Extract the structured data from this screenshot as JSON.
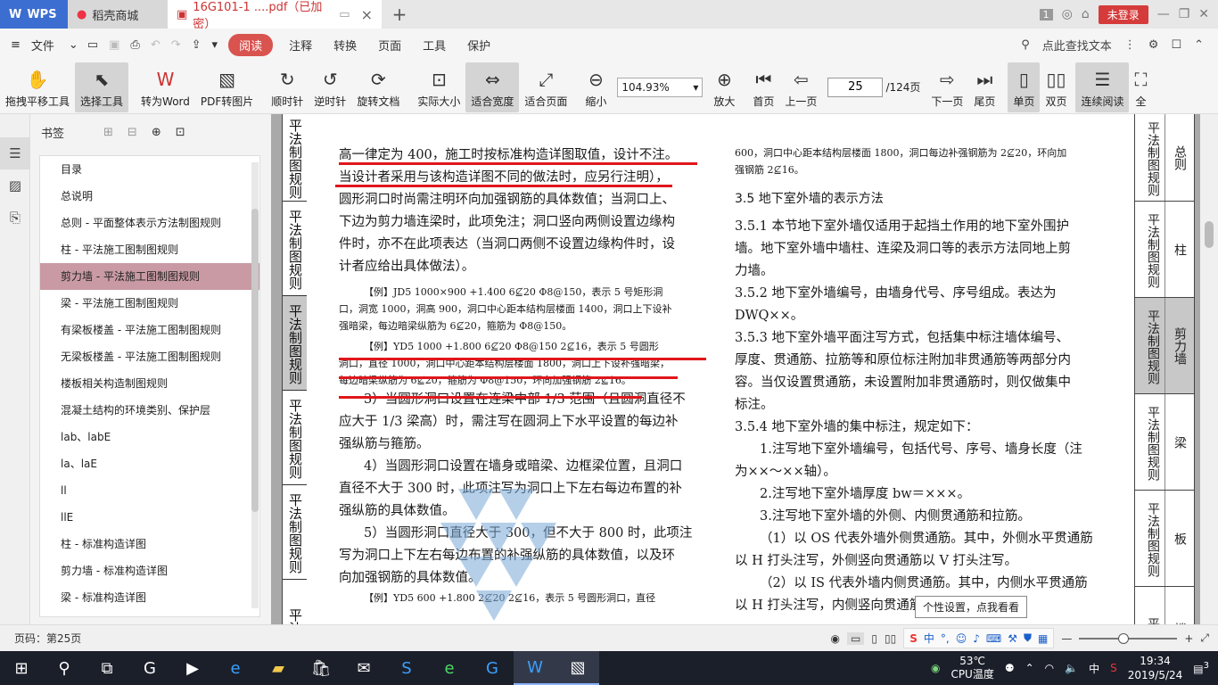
{
  "tabs": {
    "wps": "WPS",
    "shop": "稻壳商城",
    "doc": "16G101-1 ....pdf（已加密）",
    "badge": "1",
    "login": "未登录"
  },
  "menu": {
    "file": "文件",
    "items": [
      "阅读",
      "注释",
      "转换",
      "页面",
      "工具",
      "保护"
    ],
    "search": "点此查找文本"
  },
  "toolbar": {
    "hand": "拖拽平移工具",
    "select": "选择工具",
    "toword": "转为Word",
    "topic": "PDF转图片",
    "cw": "顺时针",
    "ccw": "逆时针",
    "rotate": "旋转文档",
    "actual": "实际大小",
    "fitw": "适合宽度",
    "fitp": "适合页面",
    "zoomout": "缩小",
    "zoomval": "104.93%",
    "zoomin": "放大",
    "first": "首页",
    "prev": "上一页",
    "page": "25",
    "total": "/124页",
    "next": "下一页",
    "last": "尾页",
    "single": "单页",
    "double": "双页",
    "continuous": "连续阅读",
    "full": "全"
  },
  "bookmark": {
    "title": "书签",
    "items": [
      "目录",
      "总说明",
      "总则 - 平面整体表示方法制图规则",
      "柱 - 平法施工图制图规则",
      "剪力墙 - 平法施工图制图规则",
      "梁 - 平法施工图制图规则",
      "有梁板楼盖 - 平法施工图制图规则",
      "无梁板楼盖 - 平法施工图制图规则",
      "楼板相关构造制图规则",
      "混凝土结构的环境类别、保护层",
      "lab、labE",
      "la、laE",
      "ll",
      "llE",
      "柱 - 标准构造详图",
      "剪力墙 - 标准构造详图",
      "梁 - 标准构造详图"
    ],
    "selected": 4
  },
  "sideTabs": [
    "平法制图规则",
    "平法制图规则",
    "平法制图规则",
    "平法制图规则",
    "平法制图规则",
    "平法制"
  ],
  "leftCol": [
    "高一律定为 400，施工时按标准构造详图取值，设计不注。",
    "当设计者采用与该构造详图不同的做法时，应另行注明），",
    "圆形洞口时尚需注明环向加强钢筋的具体数值；当洞口上、",
    "下边为剪力墙连梁时，此项免注；洞口竖向两侧设置边缘构",
    "件时，亦不在此项表达（当洞口两侧不设置边缘构件时，设",
    "计者应给出具体做法）。"
  ],
  "ex1": [
    "【例】JD5  1000×900  +1.400  6⊈20  Φ8@150，表示 5 号矩形洞",
    "口，洞宽 1000，洞高 900，洞口中心距本结构层楼面 1400，洞口上下设补",
    "强暗梁，每边暗梁纵筋为 6⊈20，箍筋为 Φ8@150。"
  ],
  "ex2": [
    "【例】YD5  1000  +1.800  6⊈20  Φ8@150  2⊈16，表示 5 号圆形",
    "洞口，直径 1000，洞口中心距本结构层楼面 1800，洞口上下设补强暗梁，",
    "每边暗梁纵筋为 6⊈20，箍筋为 Φ8@150，环向加强钢筋 2⊈16。"
  ],
  "leftCol2": [
    "3）当圆形洞口设置在连梁中部 1/3 范围（且圆洞直径不",
    "应大于 1/3 梁高）时，需注写在圆洞上下水平设置的每边补",
    "强纵筋与箍筋。",
    "4）当圆形洞口设置在墙身或暗梁、边框梁位置，且洞口",
    "直径不大于 300 时，此项注写为洞口上下左右每边布置的补",
    "强纵筋的具体数值。",
    "5）当圆形洞口直径大于 300，但不大于 800 时，此项注",
    "写为洞口上下左右每边布置的补强纵筋的具体数值，以及环",
    "向加强钢筋的具体数值。"
  ],
  "ex3": "【例】YD5  600  +1.800  2⊈20  2⊈16，表示 5 号圆形洞口，直径",
  "rightTop": [
    "600，洞口中心距本结构层楼面 1800，洞口每边补强钢筋为 2⊈20，环向加",
    "强钢筋 2⊈16。"
  ],
  "sec35": "3.5  地下室外墙的表示方法",
  "rightCol": [
    "3.5.1  本节地下室外墙仅适用于起挡土作用的地下室外围护",
    "墙。地下室外墙中墙柱、连梁及洞口等的表示方法同地上剪",
    "力墙。",
    "3.5.2  地下室外墙编号，由墙身代号、序号组成。表达为",
    "DWQ××。",
    "3.5.3  地下室外墙平面注写方式，包括集中标注墙体编号、",
    "厚度、贯通筋、拉筋等和原位标注附加非贯通筋等两部分内",
    "容。当仅设置贯通筋，未设置附加非贯通筋时，则仅做集中",
    "标注。",
    "3.5.4  地下室外墙的集中标注，规定如下：",
    "1.注写地下室外墙编号，包括代号、序号、墙身长度（注",
    "为××～××轴）。",
    "2.注写地下室外墙厚度 bw＝×××。",
    "3.注写地下室外墙的外侧、内侧贯通筋和拉筋。",
    "（1）以 OS 代表外墙外侧贯通筋。其中，外侧水平贯通筋",
    "以 H 打头注写，外侧竖向贯通筋以 V 打头注写。",
    "（2）以 IS 代表外墙内侧贯通筋。其中，内侧水平贯通筋",
    "以 H 打头注写，内侧竖向贯通筋以 V 打头注写。"
  ],
  "rightTabs": [
    {
      "v": "平法制图规则",
      "n": "总则"
    },
    {
      "v": "平法制图规则",
      "n": "柱"
    },
    {
      "v": "平法制图规则",
      "n": "剪力墙"
    },
    {
      "v": "平法制图规则",
      "n": "梁"
    },
    {
      "v": "平法制图规则",
      "n": "板"
    },
    {
      "v": "平法制",
      "n": "楼板"
    }
  ],
  "tooltip": "个性设置，点我看看",
  "status": {
    "page": "页码：第25页",
    "ime": "中"
  },
  "tray": {
    "temp": "53℃",
    "cpu": "CPU温度",
    "ime": "中",
    "time": "19:34",
    "date": "2019/5/24",
    "notif": "3"
  },
  "colors": {
    "accent": "#d9534f",
    "selected": "#c99aa4",
    "red": "#e0161b"
  }
}
